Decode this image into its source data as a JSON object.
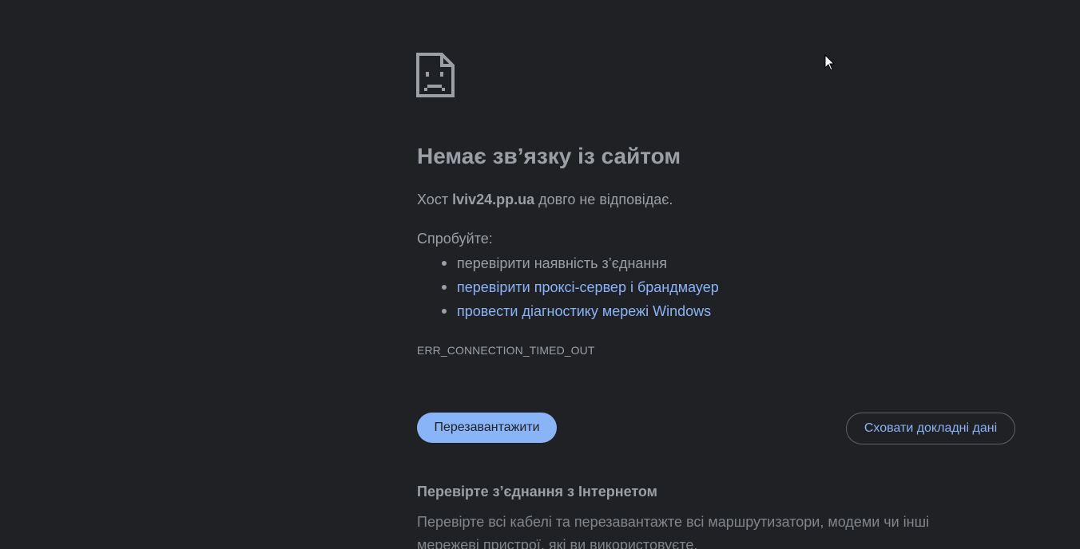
{
  "error_icon": "sad-page-icon",
  "heading": "Немає зв’язку із сайтом",
  "description": {
    "prefix": "Хост ",
    "host": "lviv24.pp.ua",
    "suffix": " довго не відповідає."
  },
  "suggestions": {
    "label": "Спробуйте:",
    "items": [
      "перевірити наявність з’єднання",
      "перевірити проксі-сервер і брандмауер",
      "провести діагностику мережі Windows"
    ]
  },
  "error_code": "ERR_CONNECTION_TIMED_OUT",
  "buttons": {
    "reload": "Перезавантажити",
    "hide_details": "Сховати докладні дані"
  },
  "details": {
    "heading": "Перевірте з’єднання з Інтернетом",
    "body": "Перевірте всі кабелі та перезавантажте всі маршрутизатори, модеми чи інші мережеві пристрої, які ви використовуєте."
  },
  "colors": {
    "background": "#202124",
    "text": "#9aa0a6",
    "link": "#8ab4f8",
    "button_primary": "#8ab4f8"
  }
}
